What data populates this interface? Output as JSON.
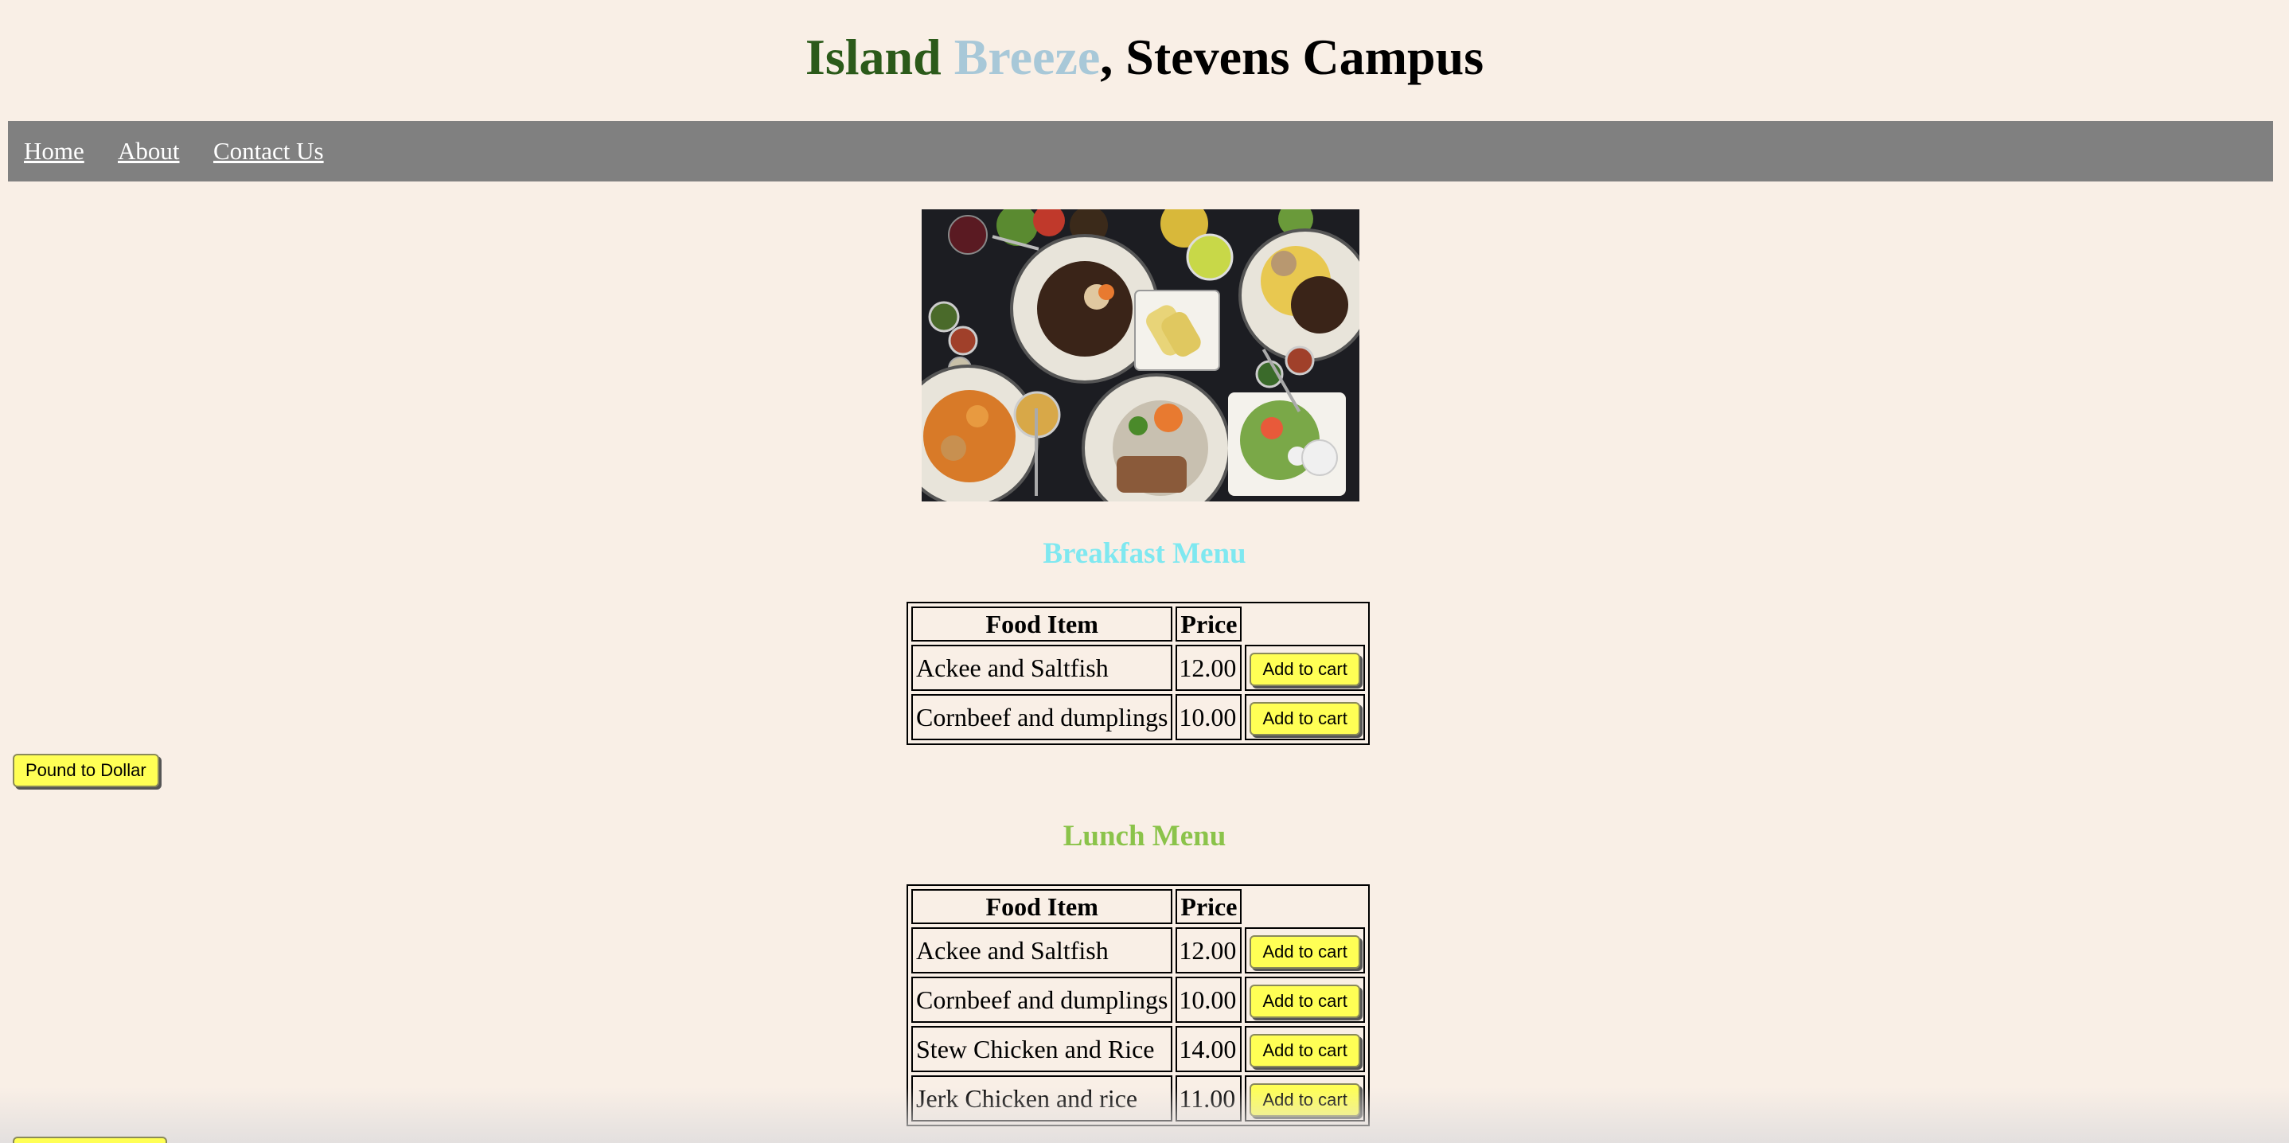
{
  "header": {
    "title_part1": "Island",
    "title_part2": "Breeze",
    "title_part3": ", Stevens Campus",
    "colors": {
      "island": "#2b5a1a",
      "breeze": "#a8c8d8"
    }
  },
  "nav": {
    "home": "Home",
    "about": "About",
    "contact": "Contact Us",
    "background": "#808080"
  },
  "hero_image": {
    "subject": "overhead photo of Caribbean dishes on a dark table"
  },
  "breakfast": {
    "title": "Breakfast Menu",
    "title_color": "#7fe8f0",
    "headers": {
      "item": "Food Item",
      "price": "Price"
    },
    "rows": [
      {
        "name": "Ackee and Saltfish",
        "price": "12.00",
        "button": "Add to cart"
      },
      {
        "name": "Cornbeef and dumplings",
        "price": "10.00",
        "button": "Add to cart"
      }
    ]
  },
  "converter": {
    "label": "Pound to Dollar"
  },
  "lunch": {
    "title": "Lunch Menu",
    "title_color": "#8bc34a",
    "headers": {
      "item": "Food Item",
      "price": "Price"
    },
    "rows": [
      {
        "name": "Ackee and Saltfish",
        "price": "12.00",
        "button": "Add to cart"
      },
      {
        "name": "Cornbeef and dumplings",
        "price": "10.00",
        "button": "Add to cart"
      },
      {
        "name": "Stew Chicken and Rice",
        "price": "14.00",
        "button": "Add to cart"
      },
      {
        "name": "Jerk Chicken and rice",
        "price": "11.00",
        "button": "Add to cart"
      }
    ]
  }
}
